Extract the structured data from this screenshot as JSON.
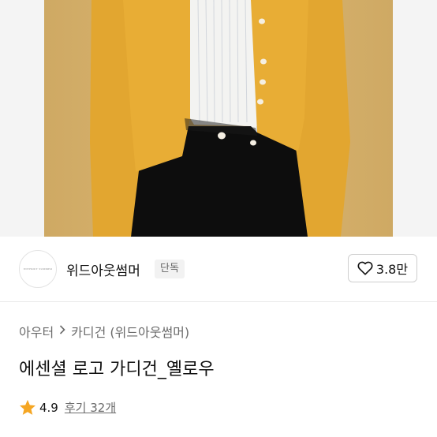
{
  "brand": {
    "logo_text": "WITHOUT SUMMER",
    "name": "위드아웃썸머",
    "badge": "단독"
  },
  "like": {
    "count": "3.8만",
    "icon": "heart-icon"
  },
  "breadcrumb": {
    "items": [
      "아우터",
      "카디건"
    ],
    "brand": "(위드아웃썸머)",
    "separator_icon": "chevron-right-icon"
  },
  "product": {
    "title": "에센셜 로고 가디건_옐로우"
  },
  "rating": {
    "icon": "star-icon",
    "value": "4.9",
    "reviews": "후기 32개"
  },
  "colors": {
    "star": "#f5a623",
    "cardigan": "#e3a92f",
    "backdrop": "#d7b36e"
  }
}
